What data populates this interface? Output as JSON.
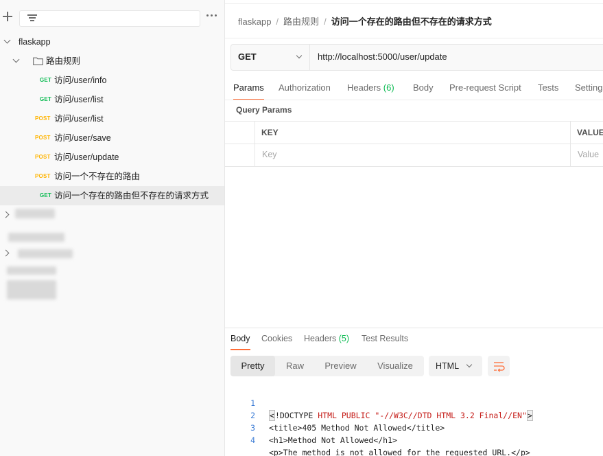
{
  "sidebar": {
    "collection_name": "flaskapp",
    "folder_name": "路由规则",
    "requests": [
      {
        "method": "GET",
        "name": "访问/user/info"
      },
      {
        "method": "GET",
        "name": "访问/user/list"
      },
      {
        "method": "POST",
        "name": "访问/user/list"
      },
      {
        "method": "POST",
        "name": "访问/user/save"
      },
      {
        "method": "POST",
        "name": "访问/user/update"
      },
      {
        "method": "POST",
        "name": "访问一个不存在的路由"
      },
      {
        "method": "GET",
        "name": "访问一个存在的路由但不存在的请求方式"
      }
    ]
  },
  "breadcrumb": {
    "collection": "flaskapp",
    "folder": "路由规则",
    "current": "访问一个存在的路由但不存在的请求方式",
    "separator": "/"
  },
  "request": {
    "method": "GET",
    "url": "http://localhost:5000/user/update"
  },
  "request_tabs": {
    "params": "Params",
    "authorization": "Authorization",
    "headers": "Headers",
    "headers_count": "(6)",
    "body": "Body",
    "prerequest": "Pre-request Script",
    "tests": "Tests",
    "settings": "Setting"
  },
  "query_params": {
    "title": "Query Params",
    "col_key": "KEY",
    "col_value": "VALUE",
    "key_placeholder": "Key",
    "value_placeholder": "Value"
  },
  "response_tabs": {
    "body": "Body",
    "cookies": "Cookies",
    "headers": "Headers",
    "headers_count": "(5)",
    "test_results": "Test Results"
  },
  "view_modes": {
    "pretty": "Pretty",
    "raw": "Raw",
    "preview": "Preview",
    "visualize": "Visualize"
  },
  "format": "HTML",
  "response_body": {
    "line_numbers": [
      "1",
      "2",
      "3",
      "4"
    ],
    "line1": {
      "open": "<",
      "doctype": "!DOCTYPE",
      "html_kw": " HTML PUBLIC ",
      "str": "\"-//W3C//DTD HTML 3.2 Final//EN\"",
      "close": ">"
    },
    "line2": "<title>405 Method Not Allowed</title>",
    "line3": "<h1>Method Not Allowed</h1>",
    "line4": "<p>The method is not allowed for the requested URL.</p>"
  },
  "colors": {
    "get": "#0cbb52",
    "post": "#ffb400",
    "accent": "#ff6c37"
  }
}
